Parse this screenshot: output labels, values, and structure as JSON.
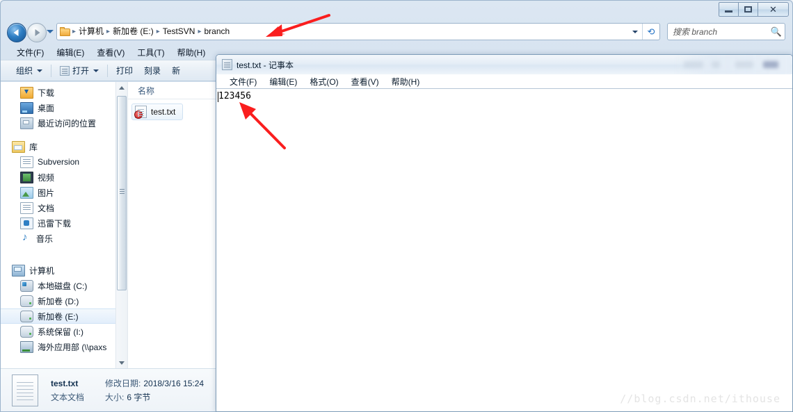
{
  "explorer": {
    "window_controls": [
      {
        "name": "minimize",
        "glyph": "minimize-icon"
      },
      {
        "name": "maximize",
        "glyph": "maximize-icon"
      },
      {
        "name": "close",
        "glyph": "close-icon"
      }
    ],
    "address": {
      "crumbs": [
        "计算机",
        "新加卷 (E:)",
        "TestSVN",
        "branch"
      ],
      "separator": "▸"
    },
    "search": {
      "placeholder": "搜索 branch",
      "icon": "search-icon"
    },
    "menubar": [
      "文件(F)",
      "编辑(E)",
      "查看(V)",
      "工具(T)",
      "帮助(H)"
    ],
    "toolbar": {
      "organize": "组织",
      "open": "打开",
      "print": "打印",
      "burn": "刻录",
      "new_partial": "新"
    },
    "sidebar": {
      "favorites": [
        {
          "label": "下载",
          "icon": "download-folder-icon"
        },
        {
          "label": "桌面",
          "icon": "desktop-icon"
        },
        {
          "label": "最近访问的位置",
          "icon": "recent-places-icon"
        }
      ],
      "libraries_group": {
        "label": "库",
        "icon": "library-icon"
      },
      "libraries": [
        {
          "label": "Subversion",
          "icon": "document-icon"
        },
        {
          "label": "视频",
          "icon": "video-icon"
        },
        {
          "label": "图片",
          "icon": "picture-icon"
        },
        {
          "label": "文档",
          "icon": "document-icon"
        },
        {
          "label": "迅雷下载",
          "icon": "thunder-download-icon"
        },
        {
          "label": "音乐",
          "icon": "music-icon"
        }
      ],
      "computer_group": {
        "label": "计算机",
        "icon": "computer-icon"
      },
      "drives": [
        {
          "label": "本地磁盘 (C:)",
          "icon": "system-drive-icon",
          "selected": false
        },
        {
          "label": "新加卷 (D:)",
          "icon": "drive-icon",
          "selected": false
        },
        {
          "label": "新加卷 (E:)",
          "icon": "drive-icon",
          "selected": true
        },
        {
          "label": "系统保留 (I:)",
          "icon": "drive-icon",
          "selected": false
        },
        {
          "label": "海外应用部 (\\\\paxs",
          "icon": "network-drive-icon",
          "selected": false
        }
      ]
    },
    "filelist": {
      "column_header": "名称",
      "rows": [
        {
          "name": "test.txt",
          "icon": "text-file-icon",
          "badge": "!",
          "badge_name": "svn-conflict-badge",
          "selected": true
        }
      ]
    },
    "details": {
      "title": "test.txt",
      "type": "文本文档",
      "modified_label": "修改日期:",
      "modified_value": "2018/3/16 15:24",
      "size_label": "大小:",
      "size_value": "6 字节"
    }
  },
  "notepad": {
    "title": "test.txt - 记事本",
    "icon": "notepad-icon",
    "menubar": [
      "文件(F)",
      "编辑(E)",
      "格式(O)",
      "查看(V)",
      "帮助(H)"
    ],
    "content": "123456"
  },
  "annotations": {
    "arrow_address_name": "red-arrow-pointing-to-branch",
    "arrow_content_name": "red-arrow-pointing-to-text",
    "arrow_color": "#fa1e1e",
    "watermark": "//blog.csdn.net/ithouse"
  }
}
